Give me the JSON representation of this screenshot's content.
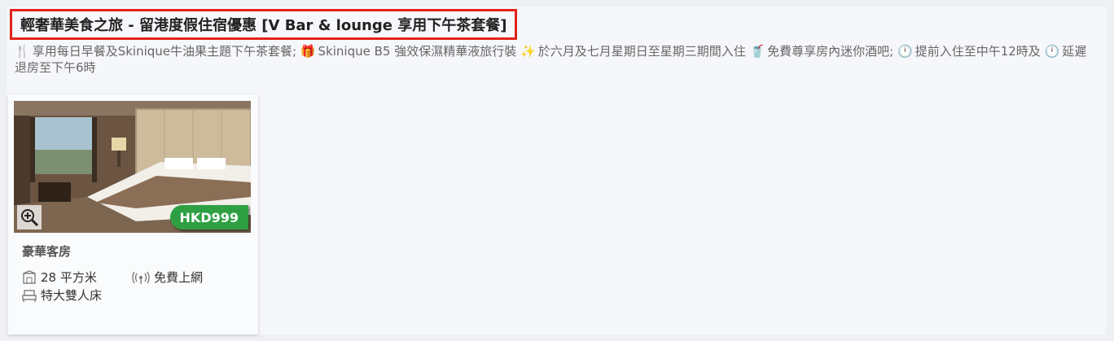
{
  "package": {
    "title": "輕奢華美食之旅 - 留港度假住宿優惠 [V Bar & lounge 享用下午茶套餐]",
    "features": [
      {
        "icon": "fork-knife-icon",
        "glyph": "🍴",
        "text": "享用每日早餐及Skinique牛油果主題下午茶套餐;"
      },
      {
        "icon": "gift-icon",
        "glyph": "🎁",
        "text": "Skinique B5 強效保濕精華液旅行裝"
      },
      {
        "icon": "sparkles-icon",
        "glyph": "✨",
        "text": "於六月及七月星期日至星期三期間入住"
      },
      {
        "icon": "drink-icon",
        "glyph": "🥤",
        "text": "免費尊享房內迷你酒吧;"
      },
      {
        "icon": "clock-icon",
        "glyph": "🕛",
        "text": "提前入住至中午12時及"
      },
      {
        "icon": "clock-icon",
        "glyph": "🕛",
        "text": "延遲退房至下午6時"
      }
    ]
  },
  "room": {
    "name": "豪華客房",
    "price": "HKD999",
    "size": "28 平方米",
    "wifi": "免費上網",
    "bed": "特大雙人床"
  },
  "colors": {
    "title_border": "#e2231a",
    "price_badge": "#2ea043"
  }
}
